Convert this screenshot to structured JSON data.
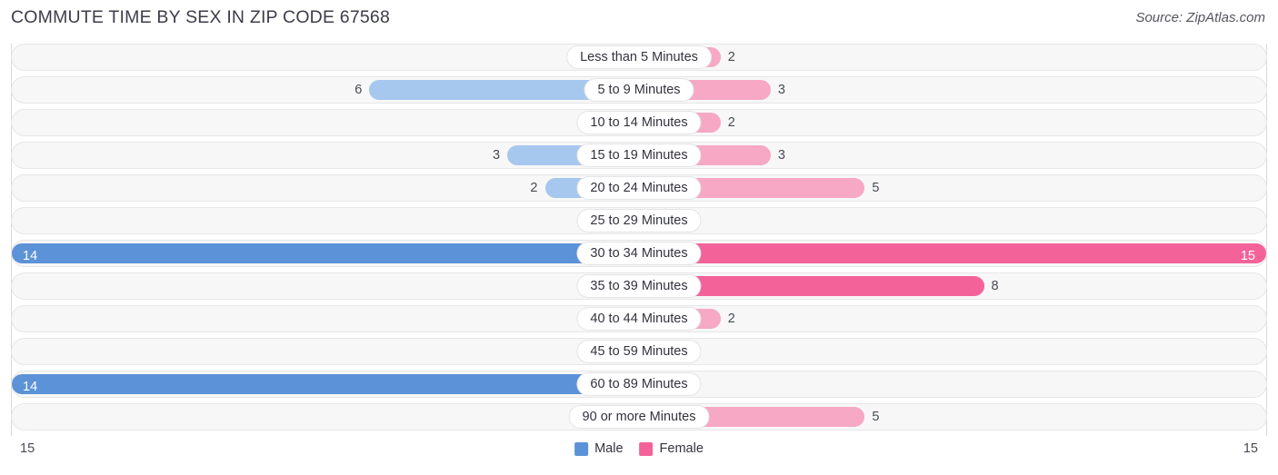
{
  "header": {
    "title": "COMMUTE TIME BY SEX IN ZIP CODE 67568",
    "source": "Source: ZipAtlas.com"
  },
  "axis": {
    "left_tick": "15",
    "right_tick": "15"
  },
  "legend": {
    "items": [
      {
        "label": "Male",
        "color": "#5b92d8"
      },
      {
        "label": "Female",
        "color": "#f4629a"
      }
    ]
  },
  "colors": {
    "male_light": "#a6c8ee",
    "male_strong": "#5b92d8",
    "female_light": "#f6a8c4",
    "female_strong": "#f4629a",
    "row_track": "#f7f7f7",
    "row_border": "#e6e6e8"
  },
  "chart_data": {
    "type": "bar",
    "title": "COMMUTE TIME BY SEX IN ZIP CODE 67568",
    "subtitle": "Source: ZipAtlas.com",
    "orientation": "horizontal-diverging",
    "xlabel": "",
    "ylabel": "",
    "xlim": [
      15,
      15
    ],
    "axis_ticks": [
      "15",
      "15"
    ],
    "grid": false,
    "legend_position": "bottom-center",
    "categories": [
      "Less than 5 Minutes",
      "5 to 9 Minutes",
      "10 to 14 Minutes",
      "15 to 19 Minutes",
      "20 to 24 Minutes",
      "25 to 29 Minutes",
      "30 to 34 Minutes",
      "35 to 39 Minutes",
      "40 to 44 Minutes",
      "45 to 59 Minutes",
      "60 to 89 Minutes",
      "90 or more Minutes"
    ],
    "series": [
      {
        "name": "Male",
        "values": [
          1,
          6,
          0,
          3,
          2,
          0,
          14,
          1,
          0,
          0,
          14,
          0
        ]
      },
      {
        "name": "Female",
        "values": [
          2,
          3,
          2,
          3,
          5,
          0,
          15,
          8,
          2,
          0,
          0,
          5
        ]
      }
    ]
  },
  "rows": [
    {
      "category": "Less than 5 Minutes",
      "male": "1",
      "female": "2",
      "male_pct": 7,
      "female_pct": 13,
      "male_strong": false,
      "female_strong": false,
      "male_inside": false,
      "female_inside": false
    },
    {
      "category": "5 to 9 Minutes",
      "male": "6",
      "female": "3",
      "male_pct": 43,
      "female_pct": 21,
      "male_strong": false,
      "female_strong": false,
      "male_inside": false,
      "female_inside": false
    },
    {
      "category": "10 to 14 Minutes",
      "male": "0",
      "female": "2",
      "male_pct": 5,
      "female_pct": 13,
      "male_strong": false,
      "female_strong": false,
      "male_inside": false,
      "female_inside": false
    },
    {
      "category": "15 to 19 Minutes",
      "male": "3",
      "female": "3",
      "male_pct": 21,
      "female_pct": 21,
      "male_strong": false,
      "female_strong": false,
      "male_inside": false,
      "female_inside": false
    },
    {
      "category": "20 to 24 Minutes",
      "male": "2",
      "female": "5",
      "male_pct": 15,
      "female_pct": 36,
      "male_strong": false,
      "female_strong": false,
      "male_inside": false,
      "female_inside": false
    },
    {
      "category": "25 to 29 Minutes",
      "male": "0",
      "female": "0",
      "male_pct": 5,
      "female_pct": 5,
      "male_strong": false,
      "female_strong": false,
      "male_inside": false,
      "female_inside": false
    },
    {
      "category": "30 to 34 Minutes",
      "male": "14",
      "female": "15",
      "male_pct": 100,
      "female_pct": 100,
      "male_strong": true,
      "female_strong": true,
      "male_inside": true,
      "female_inside": true
    },
    {
      "category": "35 to 39 Minutes",
      "male": "1",
      "female": "8",
      "male_pct": 7,
      "female_pct": 55,
      "male_strong": false,
      "female_strong": true,
      "male_inside": false,
      "female_inside": false
    },
    {
      "category": "40 to 44 Minutes",
      "male": "0",
      "female": "2",
      "male_pct": 5,
      "female_pct": 13,
      "male_strong": false,
      "female_strong": false,
      "male_inside": false,
      "female_inside": false
    },
    {
      "category": "45 to 59 Minutes",
      "male": "0",
      "female": "0",
      "male_pct": 5,
      "female_pct": 5,
      "male_strong": false,
      "female_strong": false,
      "male_inside": false,
      "female_inside": false
    },
    {
      "category": "60 to 89 Minutes",
      "male": "14",
      "female": "0",
      "male_pct": 100,
      "female_pct": 5,
      "male_strong": true,
      "female_strong": false,
      "male_inside": true,
      "female_inside": false
    },
    {
      "category": "90 or more Minutes",
      "male": "0",
      "female": "5",
      "male_pct": 5,
      "female_pct": 36,
      "male_strong": false,
      "female_strong": false,
      "male_inside": false,
      "female_inside": false
    }
  ]
}
